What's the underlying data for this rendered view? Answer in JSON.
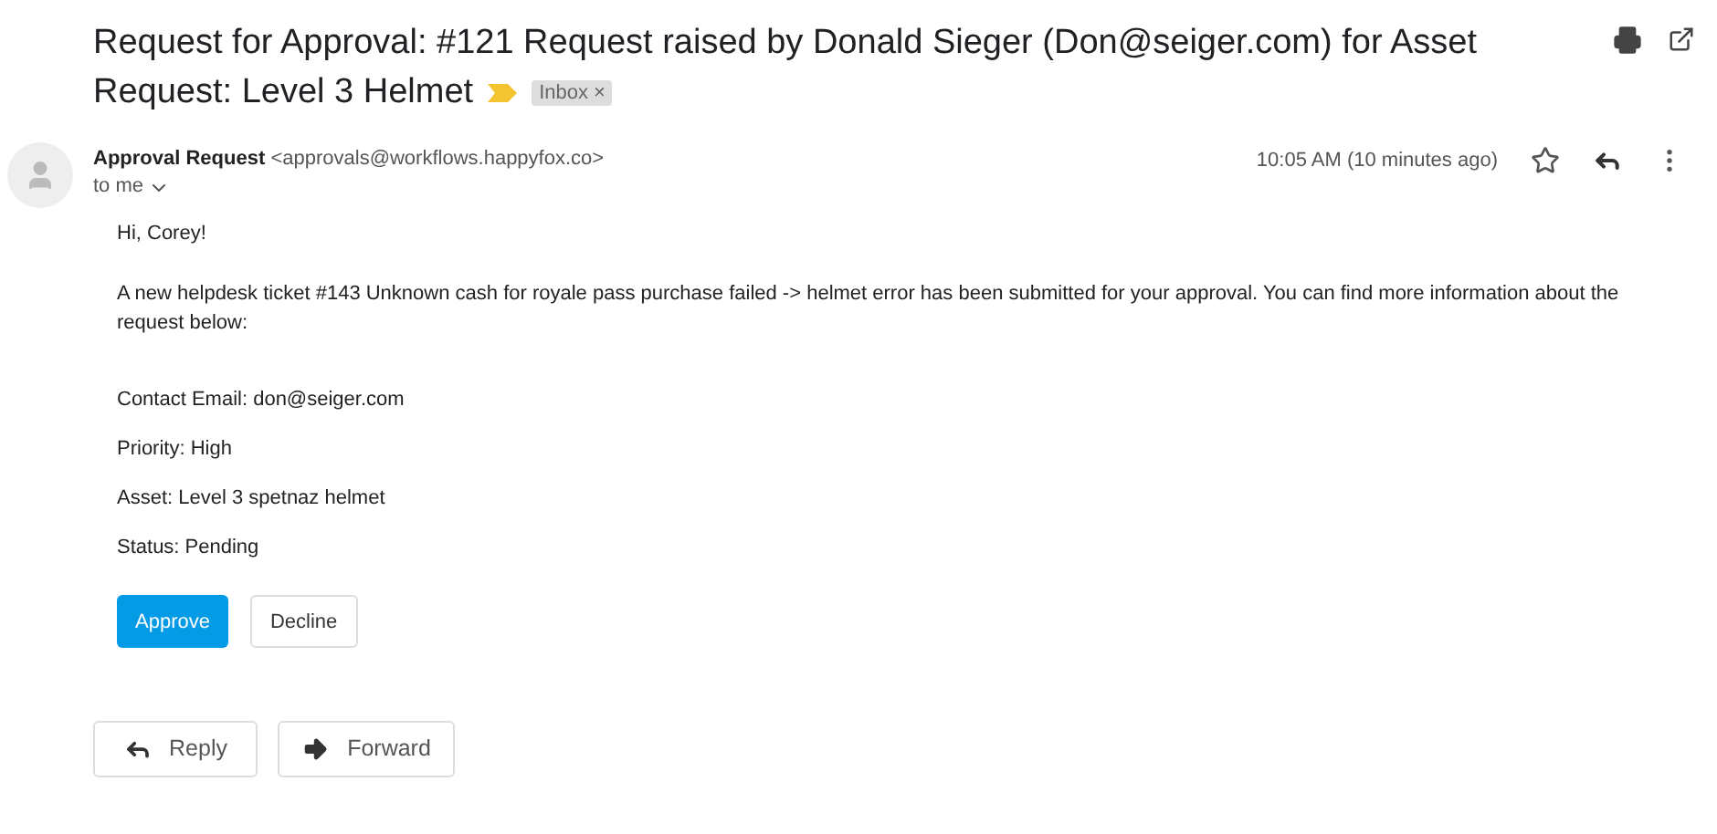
{
  "subject_lines": [
    "Request for Approval: #121 Request raised by Donald Sieger (Don@seiger.com) for Asset",
    "Request: Level 3 Helmet"
  ],
  "label": {
    "text": "Inbox",
    "close": "×"
  },
  "sender": {
    "name": "Approval Request",
    "email": "<approvals@workflows.happyfox.co>",
    "recipient": "to me",
    "time": "10:05 AM (10 minutes ago)"
  },
  "body": {
    "greeting": "Hi, Corey!",
    "intro": "A new helpdesk ticket #143 Unknown cash for royale pass purchase failed -> helmet error has been submitted for your approval. You can find more information about the request below:",
    "details": [
      "Contact Email: don@seiger.com",
      "Priority: High",
      "Asset: Level 3 spetnaz helmet",
      "Status: Pending"
    ],
    "buttons": [
      {
        "label": "Approve",
        "kind": "primary"
      },
      {
        "label": "Decline",
        "kind": "secondary"
      }
    ]
  },
  "actions": [
    {
      "label": "Reply",
      "kind": "reply"
    },
    {
      "label": "Forward",
      "kind": "forward"
    }
  ]
}
